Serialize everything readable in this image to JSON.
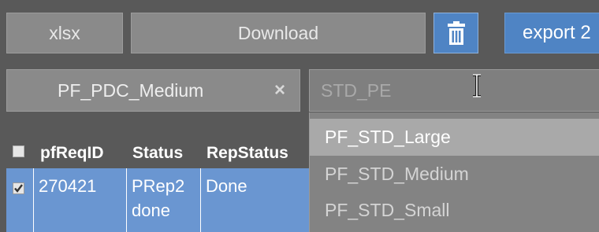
{
  "toolbar": {
    "xlsx_label": "xlsx",
    "download_label": "Download",
    "trash_icon": "trash-icon",
    "export_label": "export 2"
  },
  "filter": {
    "selected_tag": "PF_PDC_Medium",
    "remove_glyph": "×",
    "combo_placeholder": "STD_PE"
  },
  "dropdown": {
    "options": [
      {
        "label": "PF_STD_Large",
        "highlighted": true
      },
      {
        "label": "PF_STD_Medium",
        "highlighted": false
      },
      {
        "label": "PF_STD_Small",
        "highlighted": false
      }
    ]
  },
  "table": {
    "columns": [
      "pfReqID",
      "Status",
      "RepStatus"
    ],
    "rows": [
      {
        "checked": true,
        "pfReqID": "270421",
        "status_line1": "PRep2",
        "status_line2": "done",
        "RepStatus": "Done"
      }
    ]
  },
  "colors": {
    "panel_bg": "#595959",
    "button_gray": "#8a8a8a",
    "accent_blue": "#4f84c4",
    "row_selected": "#6a96d1",
    "option_highlight": "#a9a9a9"
  }
}
